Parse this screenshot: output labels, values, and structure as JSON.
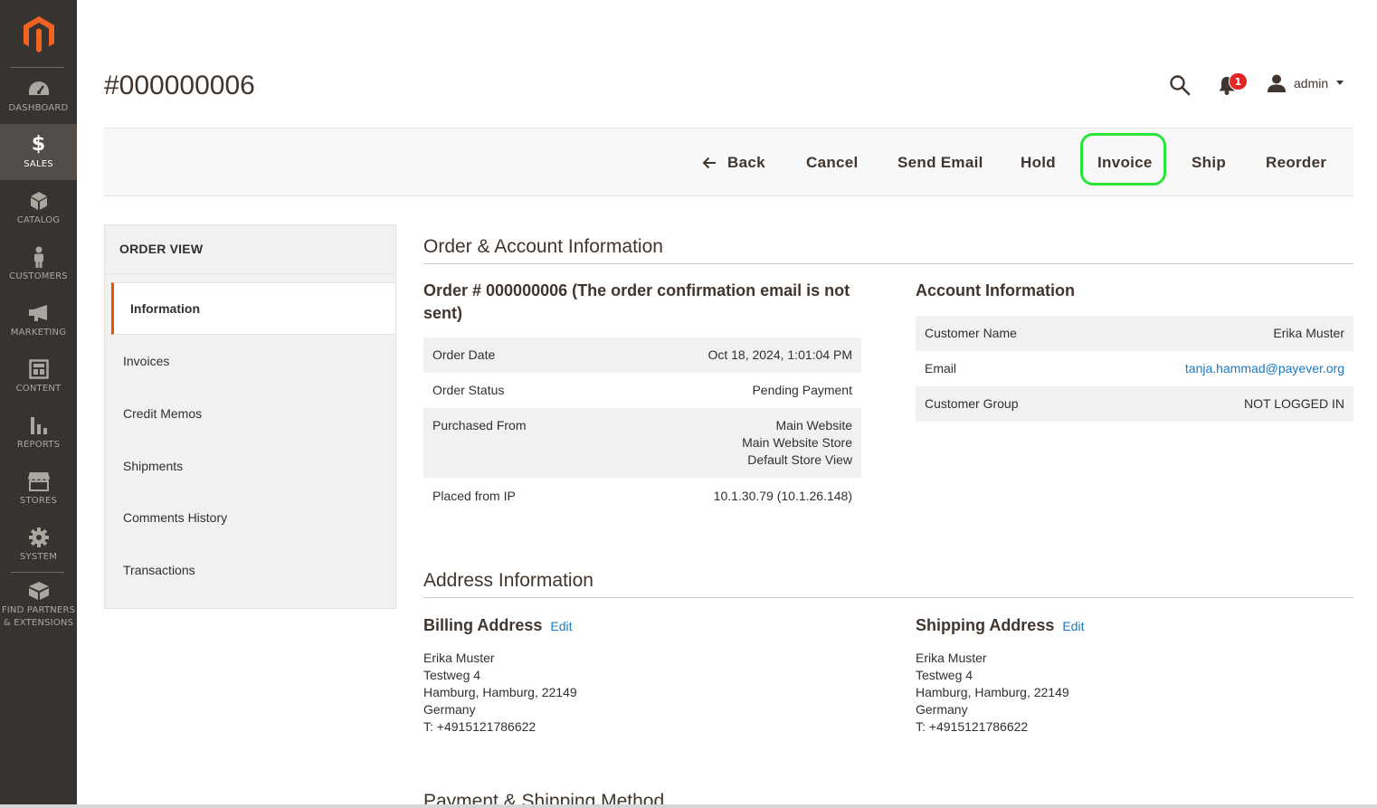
{
  "nav": {
    "items": [
      {
        "label": "DASHBOARD",
        "icon": "dashboard-icon"
      },
      {
        "label": "SALES",
        "icon": "dollar-icon",
        "active": true
      },
      {
        "label": "CATALOG",
        "icon": "cube-icon"
      },
      {
        "label": "CUSTOMERS",
        "icon": "person-icon"
      },
      {
        "label": "MARKETING",
        "icon": "megaphone-icon"
      },
      {
        "label": "CONTENT",
        "icon": "layout-icon"
      },
      {
        "label": "REPORTS",
        "icon": "bar-chart-icon"
      },
      {
        "label": "STORES",
        "icon": "storefront-icon"
      },
      {
        "label": "SYSTEM",
        "icon": "gear-icon"
      },
      {
        "label": "FIND PARTNERS & EXTENSIONS",
        "label_line1": "FIND PARTNERS",
        "label_line2": "& EXTENSIONS",
        "icon": "box-icon"
      }
    ]
  },
  "header": {
    "title": "#000000006",
    "notifications_count": "1",
    "user_name": "admin"
  },
  "toolbar": {
    "back": "Back",
    "cancel": "Cancel",
    "send_email": "Send Email",
    "hold": "Hold",
    "invoice": "Invoice",
    "ship": "Ship",
    "reorder": "Reorder",
    "highlight_color": "#2ae43a"
  },
  "order_view": {
    "title": "ORDER VIEW",
    "tabs": [
      "Information",
      "Invoices",
      "Credit Memos",
      "Shipments",
      "Comments History",
      "Transactions"
    ],
    "active_tab": "Information"
  },
  "order_account": {
    "section_title": "Order & Account Information",
    "order_heading": "Order # 000000006 (The order confirmation email is not sent)",
    "order_heading_line1": "Order # 000000006 (The order confirmation email is not",
    "order_heading_line2": "sent)",
    "order_rows": [
      {
        "label": "Order Date",
        "value": "Oct 18, 2024, 1:01:04 PM"
      },
      {
        "label": "Order Status",
        "value": "Pending Payment"
      },
      {
        "label": "Purchased From",
        "value_lines": [
          "Main Website",
          "Main Website Store",
          "Default Store View"
        ]
      },
      {
        "label": "Placed from IP",
        "value": "10.1.30.79 (10.1.26.148)"
      }
    ],
    "account_heading": "Account Information",
    "account_rows": [
      {
        "label": "Customer Name",
        "value": "Erika Muster"
      },
      {
        "label": "Email",
        "value": "tanja.hammad@payever.org"
      },
      {
        "label": "Customer Group",
        "value": "NOT LOGGED IN"
      }
    ]
  },
  "address": {
    "section_title": "Address Information",
    "edit_label": "Edit",
    "billing": {
      "heading": "Billing Address",
      "lines": [
        "Erika Muster",
        "Testweg 4",
        "Hamburg, Hamburg, 22149",
        "Germany",
        "T: +4915121786622"
      ]
    },
    "shipping": {
      "heading": "Shipping Address",
      "lines": [
        "Erika Muster",
        "Testweg 4",
        "Hamburg, Hamburg, 22149",
        "Germany",
        "T: +4915121786622"
      ]
    }
  },
  "payment_shipping": {
    "section_title": "Payment & Shipping Method"
  }
}
